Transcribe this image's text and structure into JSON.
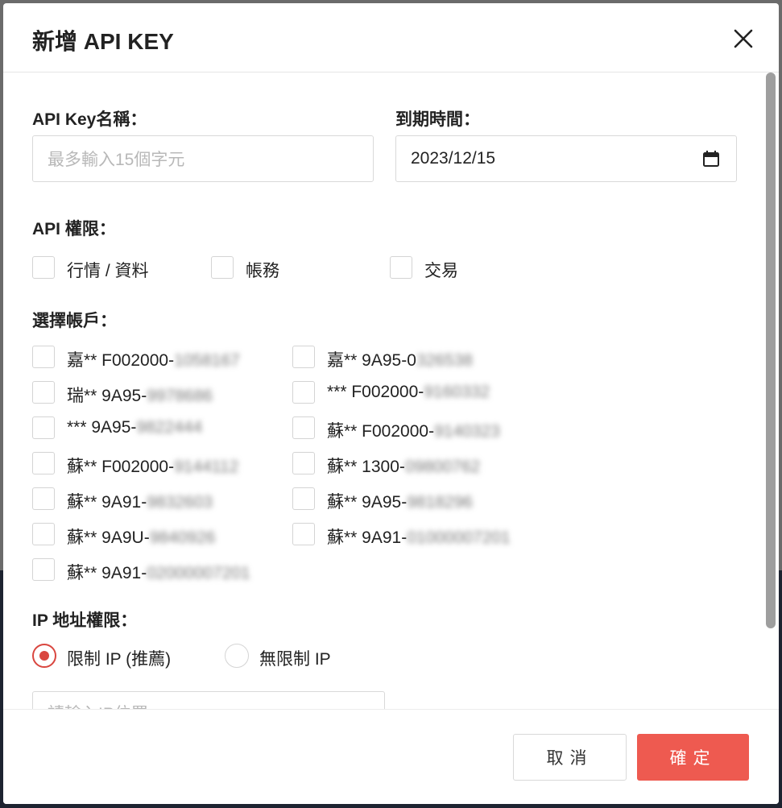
{
  "modal": {
    "title": "新增 API KEY"
  },
  "form": {
    "name_label": "API Key名稱：",
    "name_placeholder": "最多輸入15個字元",
    "expiry_label": "到期時間：",
    "expiry_value": "2023/12/15",
    "permissions_label": "API 權限：",
    "permissions": [
      "行情 / 資料",
      "帳務",
      "交易"
    ],
    "accounts_label": "選擇帳戶：",
    "accounts": [
      {
        "prefix": "嘉** F002000-",
        "hidden": "1058167"
      },
      {
        "prefix": "嘉** 9A95-0",
        "hidden": "326538"
      },
      {
        "prefix": "瑞** 9A95-",
        "hidden": "9978686"
      },
      {
        "prefix": "*** F002000-",
        "hidden": "9160332"
      },
      {
        "prefix": "*** 9A95-",
        "hidden": "9822444"
      },
      {
        "prefix": "蘇** F002000-",
        "hidden": "9140323"
      },
      {
        "prefix": "蘇** F002000-",
        "hidden": "9144112"
      },
      {
        "prefix": "蘇** 1300-",
        "hidden": "09800762"
      },
      {
        "prefix": "蘇** 9A91-",
        "hidden": "9832603"
      },
      {
        "prefix": "蘇** 9A95-",
        "hidden": "9818296"
      },
      {
        "prefix": "蘇** 9A9U-",
        "hidden": "9840926"
      },
      {
        "prefix": "蘇** 9A91-",
        "hidden": "01000007201"
      },
      {
        "prefix": "蘇** 9A91-",
        "hidden": "02000007201"
      }
    ],
    "ip_label": "IP 地址權限：",
    "ip_options": [
      "限制 IP (推薦)",
      "無限制 IP"
    ],
    "ip_selected": "限制 IP (推薦)",
    "ip_placeholder": "請輸入IP位置"
  },
  "footer": {
    "cancel_label": "取消",
    "confirm_label": "確定"
  },
  "colors": {
    "accent": "#ee5a50",
    "radio_checked": "#d9463f"
  }
}
